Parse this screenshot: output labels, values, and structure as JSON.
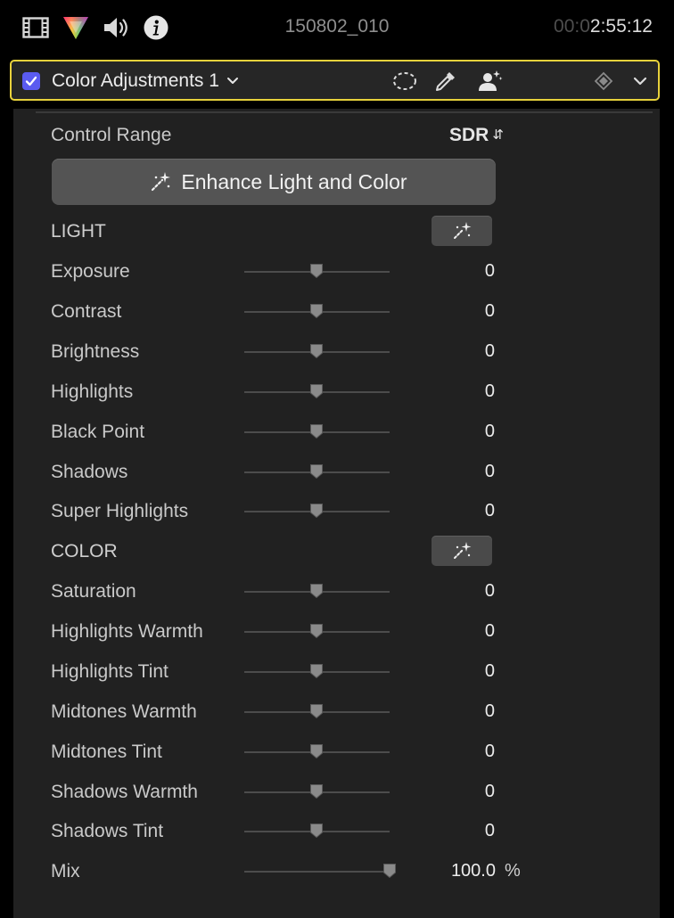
{
  "toolbar": {
    "clip_name": "150802_010",
    "timecode_dim": "00:0",
    "timecode_bright": "2:55:12",
    "icons": [
      "film-strip-icon",
      "color-wheel-icon",
      "audio-speaker-icon",
      "info-icon"
    ]
  },
  "effect": {
    "enabled": true,
    "title": "Color Adjustments 1",
    "icons": [
      "mask-shape-icon",
      "eyedropper-icon",
      "person-mask-icon",
      "keyframe-icon",
      "chevron-down-icon"
    ]
  },
  "control_range": {
    "label": "Control Range",
    "value": "SDR"
  },
  "enhance_button": {
    "label": "Enhance Light and Color"
  },
  "light_section": {
    "title": "LIGHT",
    "params": [
      {
        "label": "Exposure",
        "value": "0"
      },
      {
        "label": "Contrast",
        "value": "0"
      },
      {
        "label": "Brightness",
        "value": "0"
      },
      {
        "label": "Highlights",
        "value": "0"
      },
      {
        "label": "Black Point",
        "value": "0"
      },
      {
        "label": "Shadows",
        "value": "0"
      },
      {
        "label": "Super Highlights",
        "value": "0"
      }
    ]
  },
  "color_section": {
    "title": "COLOR",
    "params": [
      {
        "label": "Saturation",
        "value": "0"
      },
      {
        "label": "Highlights Warmth",
        "value": "0"
      },
      {
        "label": "Highlights Tint",
        "value": "0"
      },
      {
        "label": "Midtones Warmth",
        "value": "0"
      },
      {
        "label": "Midtones Tint",
        "value": "0"
      },
      {
        "label": "Shadows Warmth",
        "value": "0"
      },
      {
        "label": "Shadows Tint",
        "value": "0"
      }
    ]
  },
  "mix": {
    "label": "Mix",
    "value": "100.0",
    "unit": "%",
    "slider_fraction": 1.0
  },
  "colors": {
    "accent_checkbox": "#5a5bf0",
    "selection_border": "#e8d23c"
  }
}
